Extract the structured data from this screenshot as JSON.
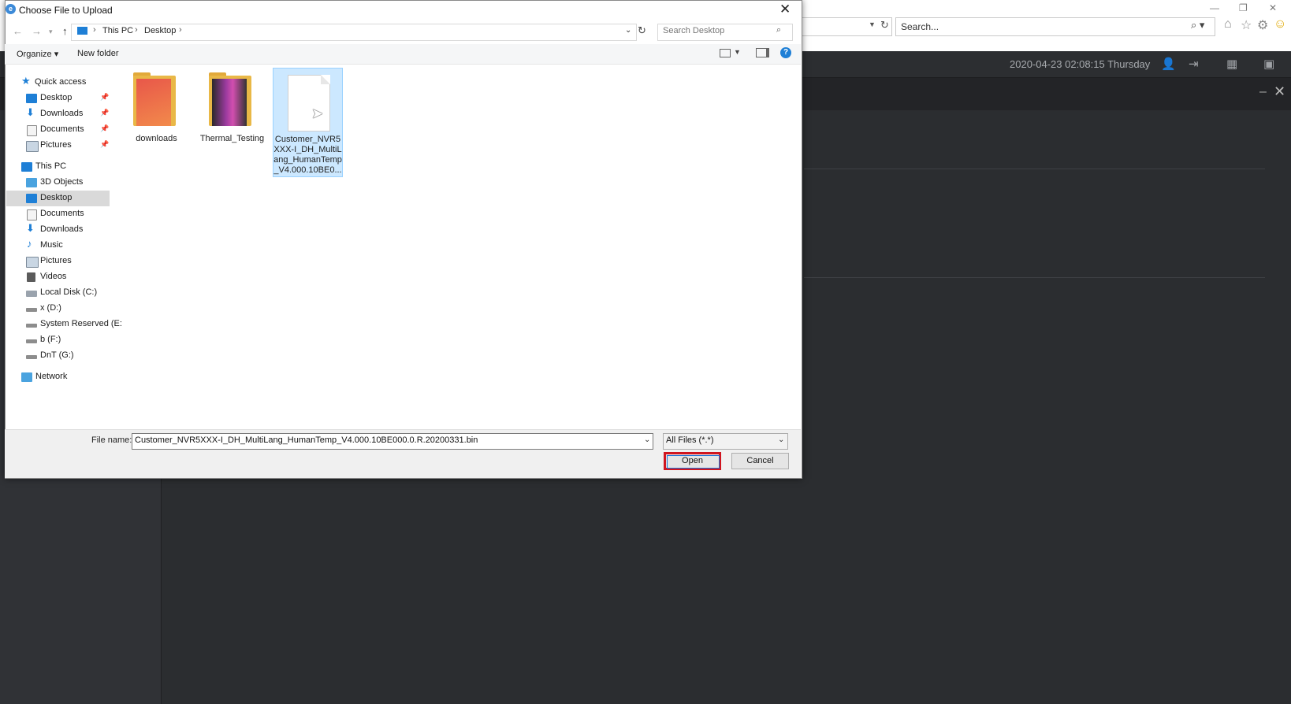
{
  "browser": {
    "search_placeholder": "Search...",
    "window_controls": [
      "minimize-icon",
      "restore-icon",
      "close-icon"
    ],
    "toolbar_icons": [
      "home-icon",
      "star-icon",
      "gear-icon",
      "smiley-icon"
    ]
  },
  "app": {
    "datetime": "2020-04-23 02:08:15 Thursday",
    "header_icons": [
      "user-icon",
      "logout-icon",
      "grid-icon",
      "monitor-icon"
    ]
  },
  "dialog": {
    "title": "Choose File to Upload",
    "breadcrumb": [
      "This PC",
      "Desktop"
    ],
    "search_placeholder": "Search Desktop",
    "commands": {
      "organize": "Organize",
      "new_folder": "New folder"
    },
    "nav": {
      "quick_access": "Quick access",
      "quick_items": [
        "Desktop",
        "Downloads",
        "Documents",
        "Pictures"
      ],
      "this_pc": "This PC",
      "pc_items": [
        "3D Objects",
        "Desktop",
        "Documents",
        "Downloads",
        "Music",
        "Pictures",
        "Videos",
        "Local Disk (C:)",
        "x (D:)",
        "System Reserved (E:",
        "b (F:)",
        "DnT (G:)"
      ],
      "network": "Network",
      "selected": "Desktop"
    },
    "files": [
      {
        "name": "downloads",
        "type": "folder"
      },
      {
        "name": "Thermal_Testing",
        "type": "folder"
      },
      {
        "name": "Customer_NVR5XXX-I_DH_MultiLang_HumanTemp_V4.000.10BE0...",
        "type": "file",
        "selected": true
      }
    ],
    "file_name_label": "File name:",
    "file_name_value": "Customer_NVR5XXX-I_DH_MultiLang_HumanTemp_V4.000.10BE000.0.R.20200331.bin",
    "file_type_value": "All Files (*.*)",
    "open_label": "Open",
    "cancel_label": "Cancel",
    "colors": {
      "highlight_border": "#d0151f",
      "selection": "#cce8ff",
      "accent": "#1e7fd6"
    }
  }
}
